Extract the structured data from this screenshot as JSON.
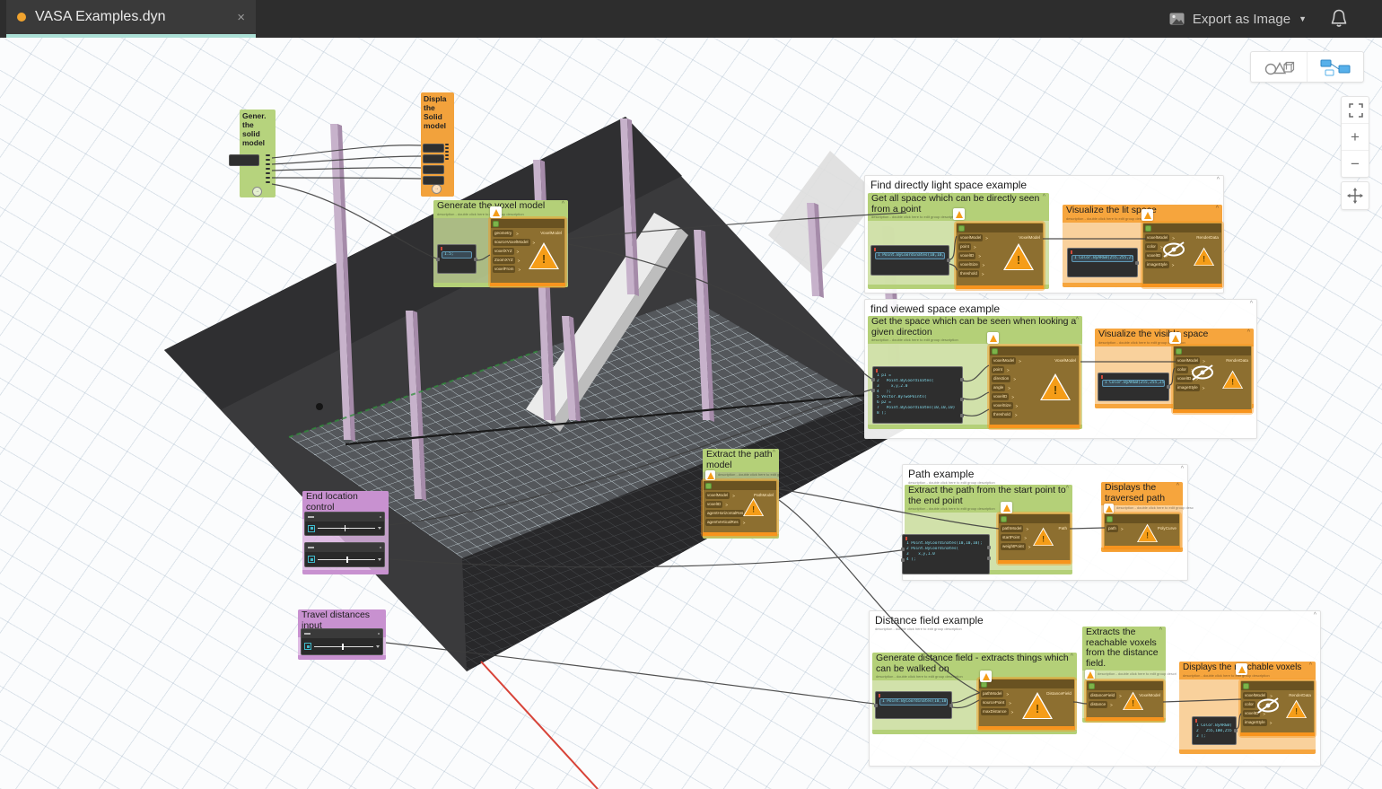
{
  "tab": {
    "title": "VASA Examples.dyn"
  },
  "topbar": {
    "export_label": "Export as Image"
  },
  "icons": {
    "close": "×",
    "caret": "▼",
    "zoom_in": "+",
    "zoom_out": "−",
    "collapse": "^",
    "note_expand": "→",
    "warning": "!"
  },
  "shared": {
    "group_desc": "description - double click here to edit group description"
  },
  "colors": {
    "accent_teal": "#abdfd5",
    "group_green": "#b4d078",
    "group_orange": "#f6a53d",
    "group_purple": "#c891d0",
    "warning": "#f59d18",
    "tab_dot": "#f0a32e"
  },
  "notes": {
    "gen_solid": {
      "title": "Gener. the solid model"
    },
    "disp_solid": {
      "title": "Displa the Solid model"
    }
  },
  "voxel_group": {
    "title": "Generate the voxel model",
    "code": [
      "1.5;"
    ],
    "node": {
      "out": "VoxelModel",
      "ports": [
        "geometry",
        "sourceVoxelModel",
        "voxelXYZ",
        "ZoomXYZ",
        "voxelFrom"
      ]
    }
  },
  "light_example": {
    "title": "Find directly light space example",
    "get_all": {
      "title": "Get all space which can be directly seen from a point",
      "code": [
        "1 Point.ByCoordinates(10,10,10);"
      ],
      "node": {
        "out": "VoxelModel",
        "ports": [
          "voxelModel",
          "point",
          "voxelID",
          "voxelSize",
          "threshold"
        ]
      }
    },
    "vis_lit": {
      "title": "Visualize the lit space",
      "code": [
        "1 Color.ByARGB(255,255,255,0);"
      ],
      "node": {
        "out": "RenderData",
        "ports": [
          "voxelModel",
          "color",
          "voxelID",
          "imageStyle"
        ]
      }
    }
  },
  "viewed_example": {
    "title": "find viewed space example",
    "get_dir": {
      "title": "Get the space which can be seen when looking a given direction",
      "code": [
        "1 p1 =",
        "2   Point.ByCoordinates(",
        "3     x,y,2.0",
        "4   );",
        "5 Vector.ByTwoPoints(",
        "6 p2 =",
        "7   Point.ByCoordinates(10,10,10)",
        "8 );",
        "9 );"
      ],
      "node": {
        "out": "VoxelModel",
        "ports": [
          "voxelModel",
          "point",
          "direction",
          "angle",
          "voxelID",
          "voxelSize",
          "threshold"
        ]
      }
    },
    "vis_visible": {
      "title": "Visualize the visible space",
      "code": [
        "1 Color.ByARGB(255,255,255,0);"
      ],
      "node": {
        "out": "RenderData",
        "ports": [
          "voxelModel",
          "color",
          "voxelID",
          "imageStyle"
        ]
      }
    }
  },
  "path_model_group": {
    "title": "Extract the path model",
    "node": {
      "out": "PathModel",
      "ports": [
        "voxelModel",
        "voxelID",
        "agentHorizontalRes",
        "agentVerticalRes"
      ]
    }
  },
  "path_example": {
    "title": "Path example",
    "extract": {
      "title": "Extract the path from the start point to the end point",
      "code": [
        "1 Point.ByCoordinates(10,10,10);",
        "2 Point.ByCoordinates(",
        "3    x,y,1.0",
        "4 );"
      ],
      "node": {
        "out": "Path",
        "ports": [
          "pathModel",
          "startPoint",
          "weightPoint"
        ]
      }
    },
    "display": {
      "title": "Displays the traversed path",
      "node": {
        "out": "PolyCurve",
        "ports": [
          "path"
        ]
      }
    }
  },
  "end_location": {
    "title": "End location control"
  },
  "travel": {
    "title": "Travel distances input"
  },
  "distance_example": {
    "title": "Distance field example",
    "generate": {
      "title": "Generate distance field - extracts things which can be walked on",
      "code": [
        "1 Point.ByCoordinates(10,10,10);"
      ],
      "node": {
        "out": "DistanceField",
        "ports": [
          "pathModel",
          "sourcePoint",
          "maxDistance"
        ]
      }
    },
    "reachable": {
      "title": "Extracts the reachable voxels from the distance field.",
      "node": {
        "out": "VoxelModel",
        "ports": [
          "distanceField",
          "distance"
        ]
      }
    },
    "display": {
      "title": "Displays the reachable voxels",
      "code": [
        "1 Color.ByARGB(",
        "2   255,100,255,0",
        "3 );"
      ],
      "node": {
        "out": "RenderData",
        "ports": [
          "voxelModel",
          "color",
          "voxelID",
          "imageStyle"
        ]
      }
    }
  }
}
